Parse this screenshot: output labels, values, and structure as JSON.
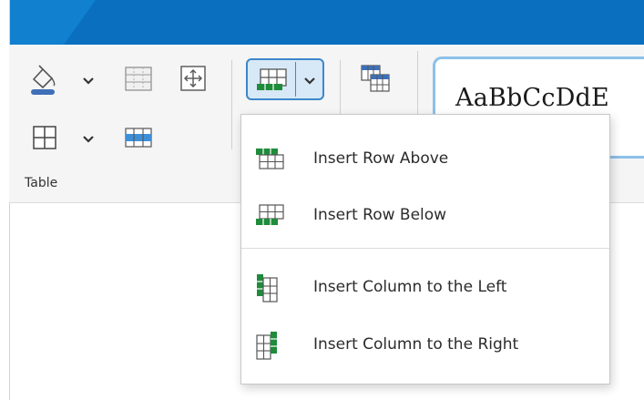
{
  "ribbon": {
    "group_label": "Table",
    "style_preview": "AaBbCcDdE"
  },
  "colors": {
    "title_bar": "#0a6fbf",
    "accent_border": "#3d87c9",
    "insert_green": "#1e8c3a"
  },
  "icons": [
    "shading-icon",
    "table-grid-icon",
    "move-icon",
    "insert-table-icon",
    "table-styles-icon",
    "borders-icon",
    "table-columns-icon",
    "chevron-down-icon"
  ],
  "menu": {
    "items": [
      {
        "label": "Insert Row Above",
        "icon": "insert-row-above-icon"
      },
      {
        "label": "Insert Row Below",
        "icon": "insert-row-below-icon"
      },
      {
        "label": "Insert Column to the Left",
        "icon": "insert-column-left-icon"
      },
      {
        "label": "Insert Column to the Right",
        "icon": "insert-column-right-icon"
      }
    ]
  }
}
